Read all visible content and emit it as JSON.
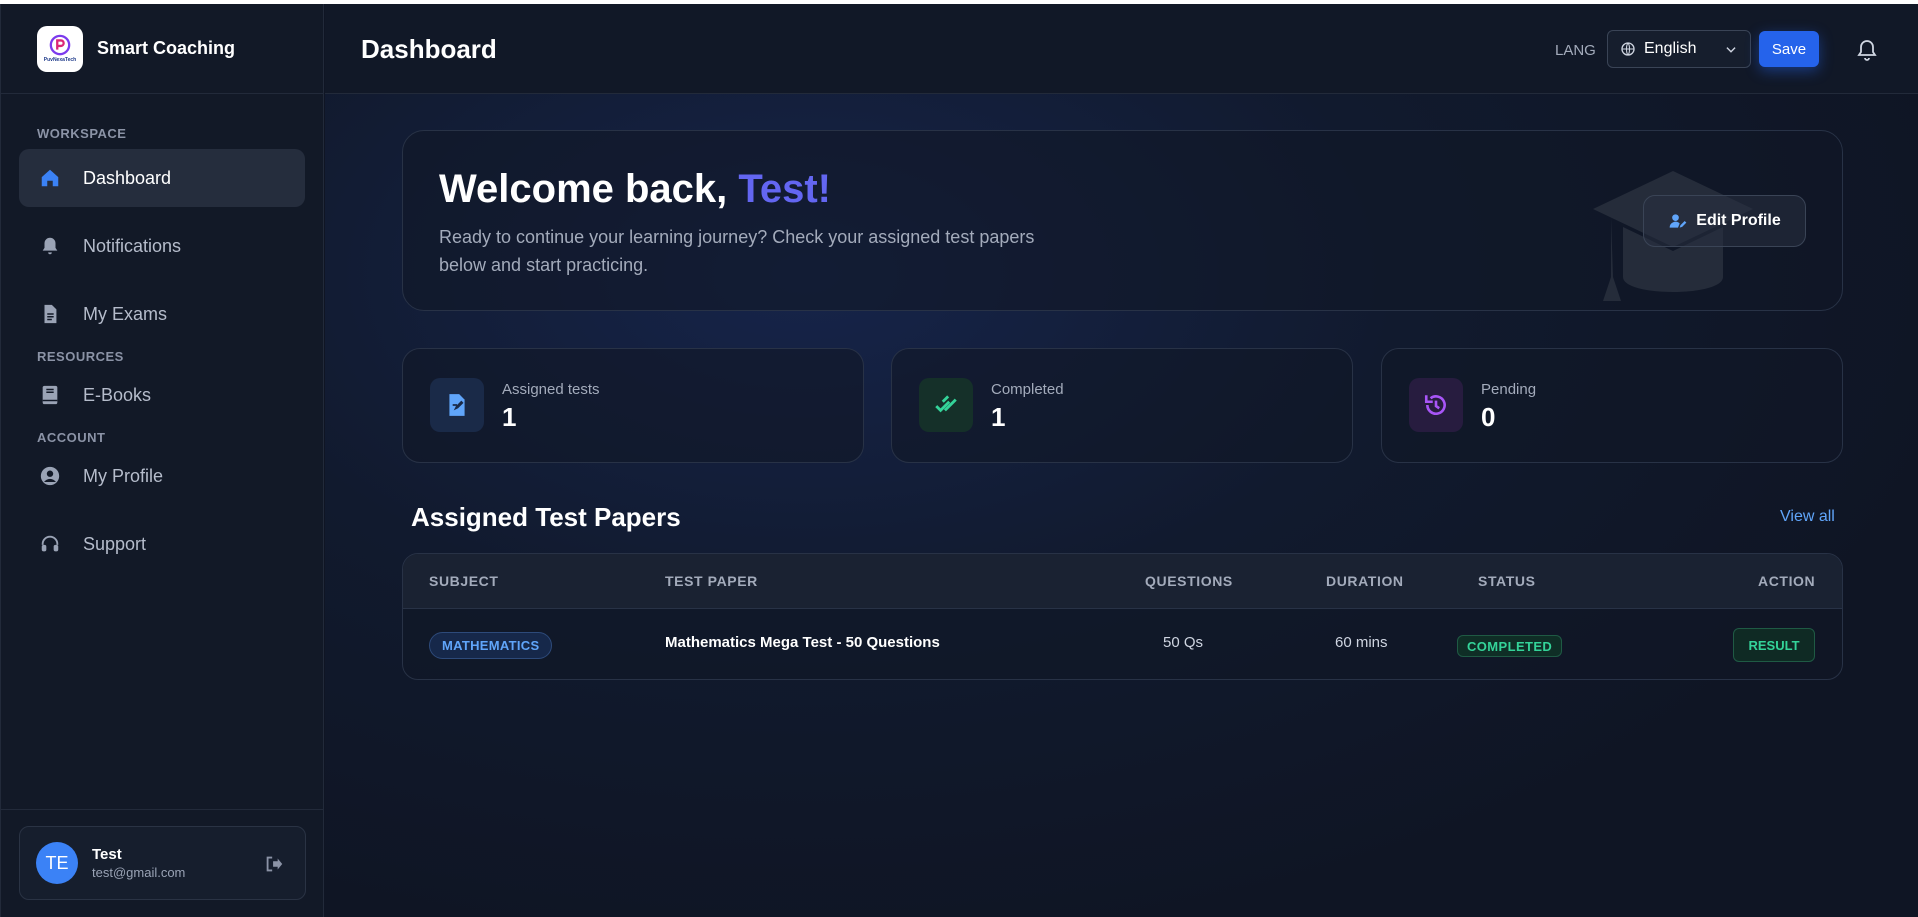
{
  "brand": {
    "name": "Smart Coaching",
    "logo_text": "PuvNexaTech",
    "logo_icon": "p-logo-icon"
  },
  "sidebar": {
    "sections": [
      "WORKSPACE",
      "RESOURCES",
      "ACCOUNT"
    ],
    "items": [
      {
        "label": "Dashboard",
        "icon": "home-icon",
        "active": true
      },
      {
        "label": "Notifications",
        "icon": "bell-icon"
      },
      {
        "label": "My Exams",
        "icon": "document-icon"
      },
      {
        "label": "E-Books",
        "icon": "book-icon"
      },
      {
        "label": "My Profile",
        "icon": "user-circle-icon"
      },
      {
        "label": "Support",
        "icon": "headset-icon"
      }
    ]
  },
  "user": {
    "initials": "TE",
    "name": "Test",
    "email": "test@gmail.com"
  },
  "header": {
    "title": "Dashboard",
    "lang_label": "LANG",
    "lang_value": "English",
    "save_label": "Save"
  },
  "welcome": {
    "greeting": "Welcome back, ",
    "name": "Test!",
    "subtitle": "Ready to continue your learning journey? Check your assigned test papers below and start practicing.",
    "edit_label": "Edit Profile"
  },
  "stats": [
    {
      "label": "Assigned tests",
      "value": "1",
      "color": "#3b82f6"
    },
    {
      "label": "Completed",
      "value": "1",
      "color": "#34d399"
    },
    {
      "label": "Pending",
      "value": "0",
      "color": "#a855f7"
    }
  ],
  "papers": {
    "title": "Assigned Test Papers",
    "view_all": "View all",
    "columns": [
      "SUBJECT",
      "TEST PAPER",
      "QUESTIONS",
      "DURATION",
      "STATUS",
      "ACTION"
    ],
    "rows": [
      {
        "subject": "MATHEMATICS",
        "paper": "Mathematics Mega Test - 50 Questions",
        "questions": "50 Qs",
        "duration": "60 mins",
        "status": "COMPLETED",
        "action": "RESULT"
      }
    ]
  },
  "colors": {
    "accent": "#2563eb",
    "brand_name_highlight": "#6366f1",
    "success": "#34d399"
  }
}
